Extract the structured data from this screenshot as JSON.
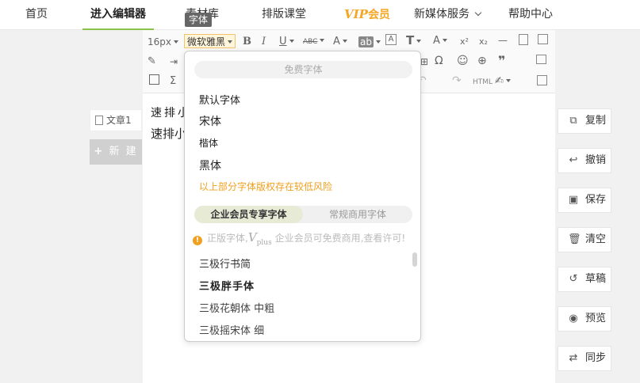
{
  "nav": {
    "home": "首页",
    "editor": "进入编辑器",
    "library": "素材库",
    "course": "排版课堂",
    "vip_v": "V",
    "vip_ip": "IP",
    "vip_member": "会员",
    "media": "新媒体服务",
    "help": "帮助中心"
  },
  "tooltip": "字体",
  "toolbar": {
    "font_size": "16px",
    "font_family": "微软雅黑",
    "bold": "B",
    "italic": "I",
    "underline": "U",
    "strike": "ABC",
    "font_color": "A",
    "bg_color": "ab",
    "html": "HTML",
    "omega": "Ω",
    "sigma": "Σ",
    "quote": "❞"
  },
  "docs": {
    "item": "文章1",
    "new": "新 建"
  },
  "editor": {
    "line1": "速排小",
    "line2": "速排小"
  },
  "dropdown": {
    "free_header": "免费字体",
    "fonts": [
      "默认字体",
      "宋体",
      "楷体",
      "黑体"
    ],
    "warning": "以上部分字体版权存在较低风险",
    "tab_active": "企业会员专享字体",
    "tab_inactive": "常规商用字体",
    "notice_prefix": "正版字体,",
    "notice_v": "V",
    "notice_plus": "plus",
    "notice_suffix": "企业会员可免费商用,查看许可!",
    "premium_fonts": [
      "三极行书简",
      "三极胖手体",
      "三极花朝体 中粗",
      "三极摇宋体 细"
    ]
  },
  "sidebar": {
    "copy": "复制",
    "undo": "撤销",
    "save": "保存",
    "clear": "清空",
    "draft": "草稿",
    "preview": "预览",
    "sync": "同步"
  },
  "colors": {
    "accent_green": "#8bc34a",
    "vip_orange": "#f5a623",
    "warning_orange": "#f0a020"
  }
}
